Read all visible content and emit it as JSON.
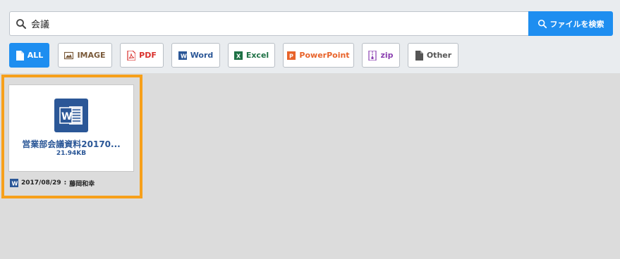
{
  "search": {
    "value": "会議",
    "button_label": "ファイルを検索"
  },
  "filters": [
    {
      "label": "ALL",
      "icon": "file-icon",
      "color": "#ffffff",
      "active": true
    },
    {
      "label": "IMAGE",
      "icon": "image-icon",
      "color": "#7a5a3a"
    },
    {
      "label": "PDF",
      "icon": "pdf-icon",
      "color": "#d9302c"
    },
    {
      "label": "Word",
      "icon": "word-icon",
      "color": "#2b5797"
    },
    {
      "label": "Excel",
      "icon": "excel-icon",
      "color": "#1e7145"
    },
    {
      "label": "PowerPoint",
      "icon": "powerpoint-icon",
      "color": "#e8632a"
    },
    {
      "label": "zip",
      "icon": "zip-icon",
      "color": "#8a3fb0"
    },
    {
      "label": "Other",
      "icon": "file-icon",
      "color": "#555555"
    }
  ],
  "files": [
    {
      "name": "営業部会議資料20170...",
      "size": "21.94KB",
      "date": "2017/08/29",
      "owner": "藤岡和幸",
      "type_icon": "word-icon",
      "selected": true
    }
  ],
  "colors": {
    "accent": "#1e8ef0",
    "selection": "#f7a01b",
    "word": "#2b5797"
  }
}
